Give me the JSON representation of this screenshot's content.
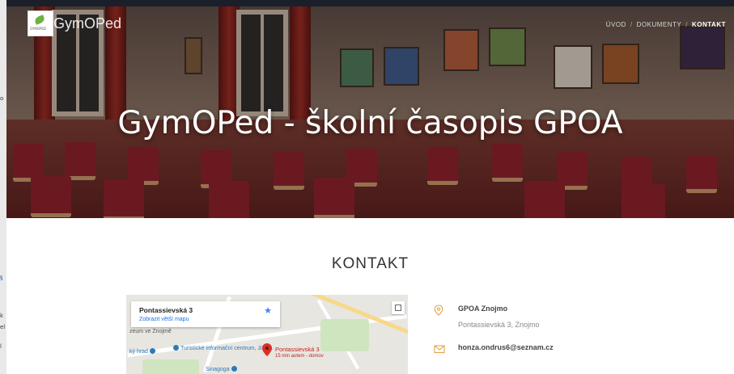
{
  "background_window": {
    "fragments": [
      "o",
      "§",
      "k",
      "el",
      "l"
    ]
  },
  "header": {
    "logo_small_text": "GYMOPED",
    "brand": "GymOPed",
    "nav": [
      {
        "label": "ÚVOD",
        "active": false
      },
      {
        "label": "DOKUMENTY",
        "active": false
      },
      {
        "label": "KONTAKT",
        "active": true
      }
    ],
    "nav_separator": "/"
  },
  "hero": {
    "title": "GymOPed - školní časopis GPOA"
  },
  "section": {
    "title": "KONTAKT"
  },
  "map": {
    "card_address": "Pontassievská 3",
    "card_link": "Zobrazit větší mapu",
    "pin_label": "Pontassievská 3",
    "pin_sub": "15 min autem - domov",
    "poi_1": "Turistické informační centrum, Jižní...",
    "poi_2": "ký hrad",
    "poi_3": "zeum ve Znojmě",
    "poi_4": "Sinagoga",
    "colors": {
      "pin": "#d93025",
      "link": "#1a73e8",
      "poi": "#2b7bb9"
    }
  },
  "contact": {
    "org_name": "GPOA Znojmo",
    "address": "Pontassievská 3, Znojmo",
    "email": "honza.ondrus6@seznam.cz",
    "icons": [
      "location-pin-icon",
      "envelope-icon"
    ]
  }
}
